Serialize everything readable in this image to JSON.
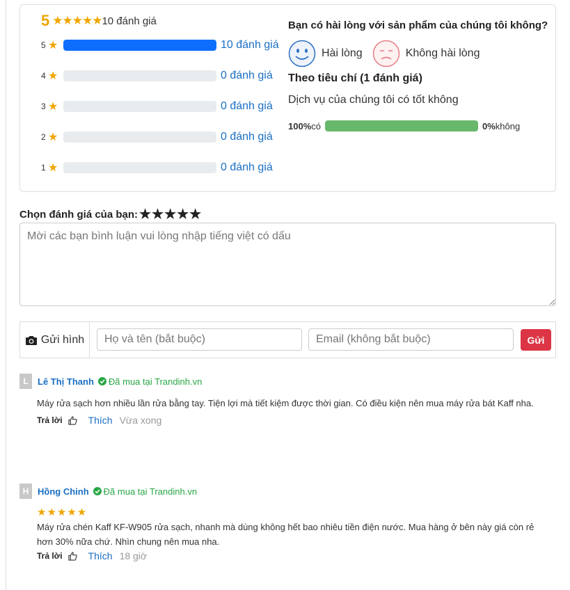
{
  "summary": {
    "average": "5",
    "stars": "★★★★★",
    "total_label": "10 đánh giá",
    "rows": [
      {
        "level": "5",
        "star": "★",
        "fraction": 1.0,
        "count_label": "10 đánh giá"
      },
      {
        "level": "4",
        "star": "★",
        "fraction": 0,
        "count_label": "0 đánh giá"
      },
      {
        "level": "3",
        "star": "★",
        "fraction": 0,
        "count_label": "0 đánh giá"
      },
      {
        "level": "2",
        "star": "★",
        "fraction": 0,
        "count_label": "0 đánh giá"
      },
      {
        "level": "1",
        "star": "★",
        "fraction": 0,
        "count_label": "0 đánh giá"
      }
    ],
    "bar_color": "#0d6efd",
    "star_color": "#f0a500"
  },
  "satisfaction": {
    "question": "Bạn có hài lòng với sản phẩm của chúng tôi không?",
    "happy_label": "Hài lòng",
    "unhappy_label": "Không hài lòng",
    "criteria_title": "Theo tiêu chí (1 đánh giá)",
    "criteria_question": "Dịch vụ của chúng tôi có tốt không",
    "yes_percent": "100%",
    "yes_label": " có",
    "yes_fraction": 1.0,
    "no_percent": "0%",
    "no_label": " không",
    "bar_color": "#68b86c"
  },
  "rate": {
    "label": "Chọn đánh giá của bạn:",
    "stars": "★★★★★"
  },
  "comment_form": {
    "placeholder": "Mời các bạn bình luận vui lòng nhập tiếng việt có dấu",
    "photo_label": "Gửi hình",
    "name_placeholder": "Họ và tên (bắt buộc)",
    "email_placeholder": "Email (không bắt buộc)",
    "send_label": "Gửi"
  },
  "comments": [
    {
      "initial": "L",
      "name": "Lê Thị Thanh",
      "verified": "Đã mua tại Trandinh.vn",
      "stars": "",
      "text": "Máy rửa sạch hơn nhiều lần rửa bằng tay. Tiện lợi mà tiết kiệm được thời gian. Có điều kiện nên mua máy rửa bát Kaff nha.",
      "reply": "Trả lời",
      "like": "Thích",
      "time": "Vừa xong"
    },
    {
      "initial": "H",
      "name": "Hồng Chinh",
      "verified": "Đã mua tại Trandinh.vn",
      "stars": "★★★★★",
      "text": "Máy rửa chén Kaff KF-W905 rửa sạch, nhanh mà dùng không hết bao nhiêu tiền điện nước. Mua hàng ở bên này giá còn rẻ hơn 30% nữa chứ. Nhìn chung nên mua nha.",
      "reply": "Trả lời",
      "like": "Thích",
      "time": "18 giờ"
    }
  ]
}
